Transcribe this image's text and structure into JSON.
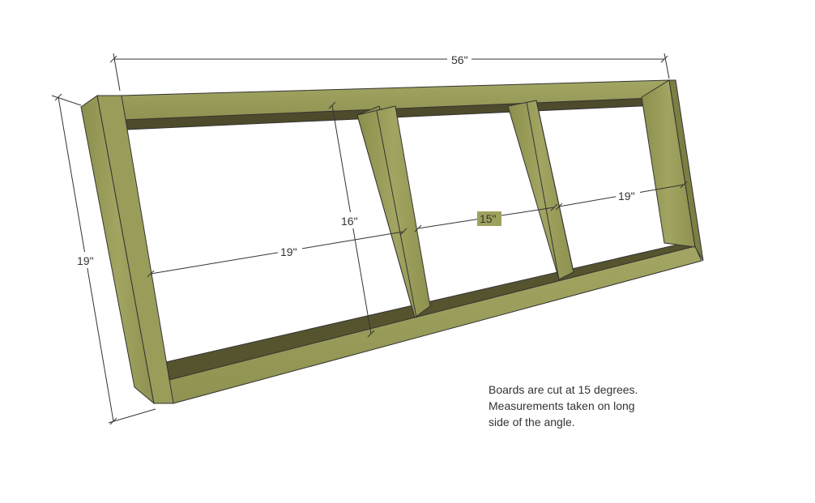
{
  "dimensions": {
    "overall_width": "56\"",
    "overall_height": "19\"",
    "inner_height": "16\"",
    "left_opening": "19\"",
    "middle_opening": "15\"",
    "right_opening": "19\""
  },
  "note": {
    "line1": "Boards are cut at 15 degrees.",
    "line2": "Measurements taken on long",
    "line3": "side of the angle."
  },
  "colors": {
    "wood_light": "#9ea15c",
    "wood_mid": "#8a8d4c",
    "wood_dark": "#5e5d33",
    "shelf_inner": "#4d4b2b",
    "line": "#333333"
  }
}
